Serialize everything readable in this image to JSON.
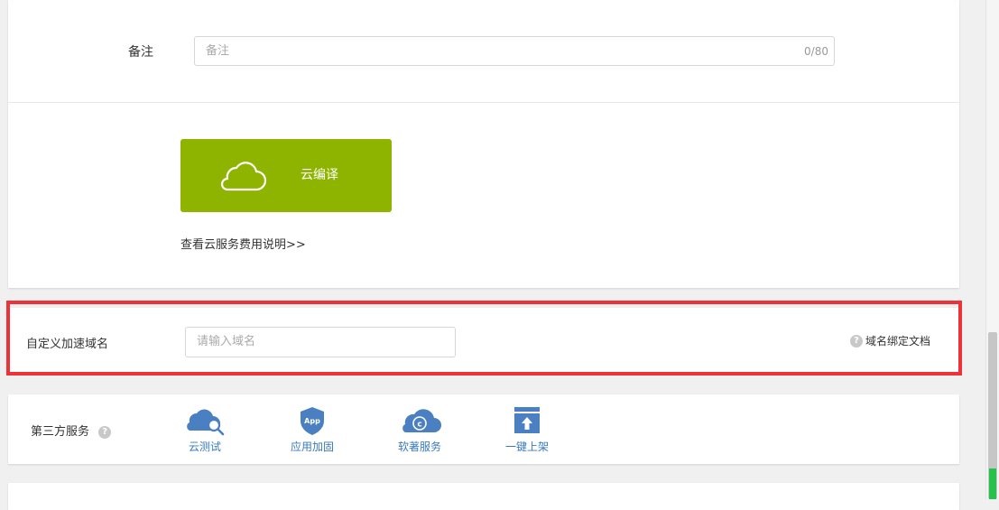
{
  "remark": {
    "label": "备注",
    "placeholder": "备注",
    "counter": "0/80"
  },
  "compile": {
    "button_label": "云编译",
    "fee_link": "查看云服务费用说明>>"
  },
  "domain": {
    "label": "自定义加速域名",
    "placeholder": "请输入域名",
    "doc_link": "域名绑定文档"
  },
  "third_party": {
    "label": "第三方服务",
    "services": [
      {
        "label": "云测试",
        "icon": "cloud-search-icon"
      },
      {
        "label": "应用加固",
        "icon": "app-shield-icon"
      },
      {
        "label": "软著服务",
        "icon": "copyright-cloud-icon"
      },
      {
        "label": "一键上架",
        "icon": "upload-box-icon"
      }
    ]
  },
  "colors": {
    "compile_button": "#8fb400",
    "highlight_border": "#ee3338",
    "service_icon": "#4a7fc1"
  }
}
